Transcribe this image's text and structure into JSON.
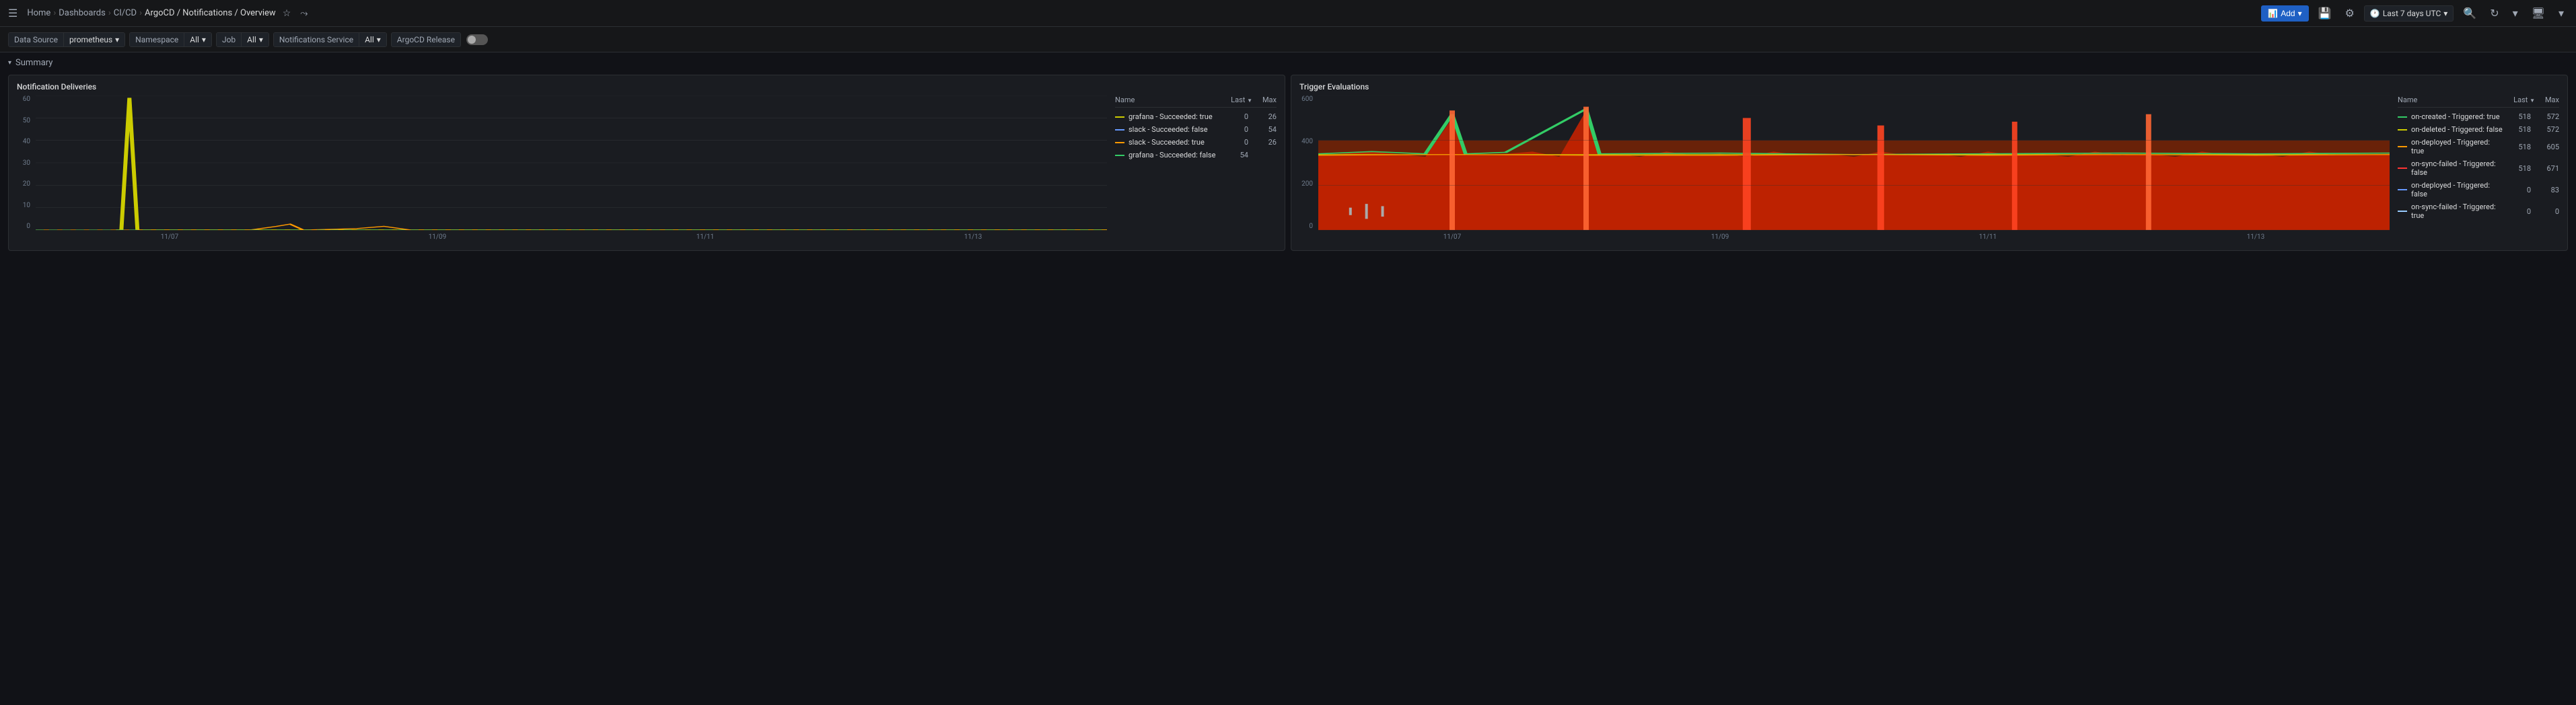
{
  "topnav": {
    "breadcrumb": [
      "Home",
      "Dashboards",
      "CI/CD",
      "ArgoCD / Notifications / Overview"
    ],
    "separators": [
      ">",
      ">",
      ">"
    ],
    "add_label": "Add",
    "time_range": "Last 7 days UTC",
    "save_icon": "💾",
    "settings_icon": "⚙",
    "zoom_out_icon": "🔍",
    "refresh_icon": "↻",
    "screen_icon": "🖥"
  },
  "filterbar": {
    "datasource_label": "Data Source",
    "datasource_value": "prometheus",
    "namespace_label": "Namespace",
    "namespace_value": "All",
    "job_label": "Job",
    "job_value": "All",
    "notifications_label": "Notifications Service",
    "notifications_value": "All",
    "argocd_label": "ArgoCD Release",
    "toggle_state": false
  },
  "summary": {
    "section_label": "Summary"
  },
  "notification_deliveries": {
    "title": "Notification Deliveries",
    "y_axis": [
      "60",
      "50",
      "40",
      "30",
      "20",
      "10",
      "0"
    ],
    "x_axis": [
      "11/07",
      "11/09",
      "11/11",
      "11/13"
    ],
    "legend_header": {
      "name": "Name",
      "last": "Last",
      "max": "Max"
    },
    "legend_items": [
      {
        "name": "grafana - Succeeded: true",
        "last": "0",
        "max": "26",
        "color": "#CCCC00",
        "dash": false
      },
      {
        "name": "slack - Succeeded: false",
        "last": "0",
        "max": "54",
        "color": "#6699FF",
        "dash": false
      },
      {
        "name": "slack - Succeeded: true",
        "last": "0",
        "max": "26",
        "color": "#FF9900",
        "dash": false
      },
      {
        "name": "grafana - Succeeded: false",
        "last": "54",
        "max": "",
        "color": "#33CC66",
        "dash": false
      }
    ]
  },
  "trigger_evaluations": {
    "title": "Trigger Evaluations",
    "y_axis": [
      "600",
      "400",
      "200",
      "0"
    ],
    "x_axis": [
      "11/07",
      "11/09",
      "11/11",
      "11/13"
    ],
    "legend_header": {
      "name": "Name",
      "last": "Last",
      "max": "Max"
    },
    "legend_items": [
      {
        "name": "on-created - Triggered: true",
        "last": "518",
        "max": "572",
        "color": "#33CC66"
      },
      {
        "name": "on-deleted - Triggered: false",
        "last": "518",
        "max": "572",
        "color": "#CCCC00"
      },
      {
        "name": "on-deployed - Triggered: true",
        "last": "518",
        "max": "605",
        "color": "#FF9900"
      },
      {
        "name": "on-sync-failed - Triggered: false",
        "last": "518",
        "max": "671",
        "color": "#FF3333"
      },
      {
        "name": "on-deployed - Triggered: false",
        "last": "0",
        "max": "83",
        "color": "#6699FF"
      },
      {
        "name": "on-sync-failed - Triggered: true",
        "last": "0",
        "max": "0",
        "color": "#99CCFF"
      }
    ]
  }
}
